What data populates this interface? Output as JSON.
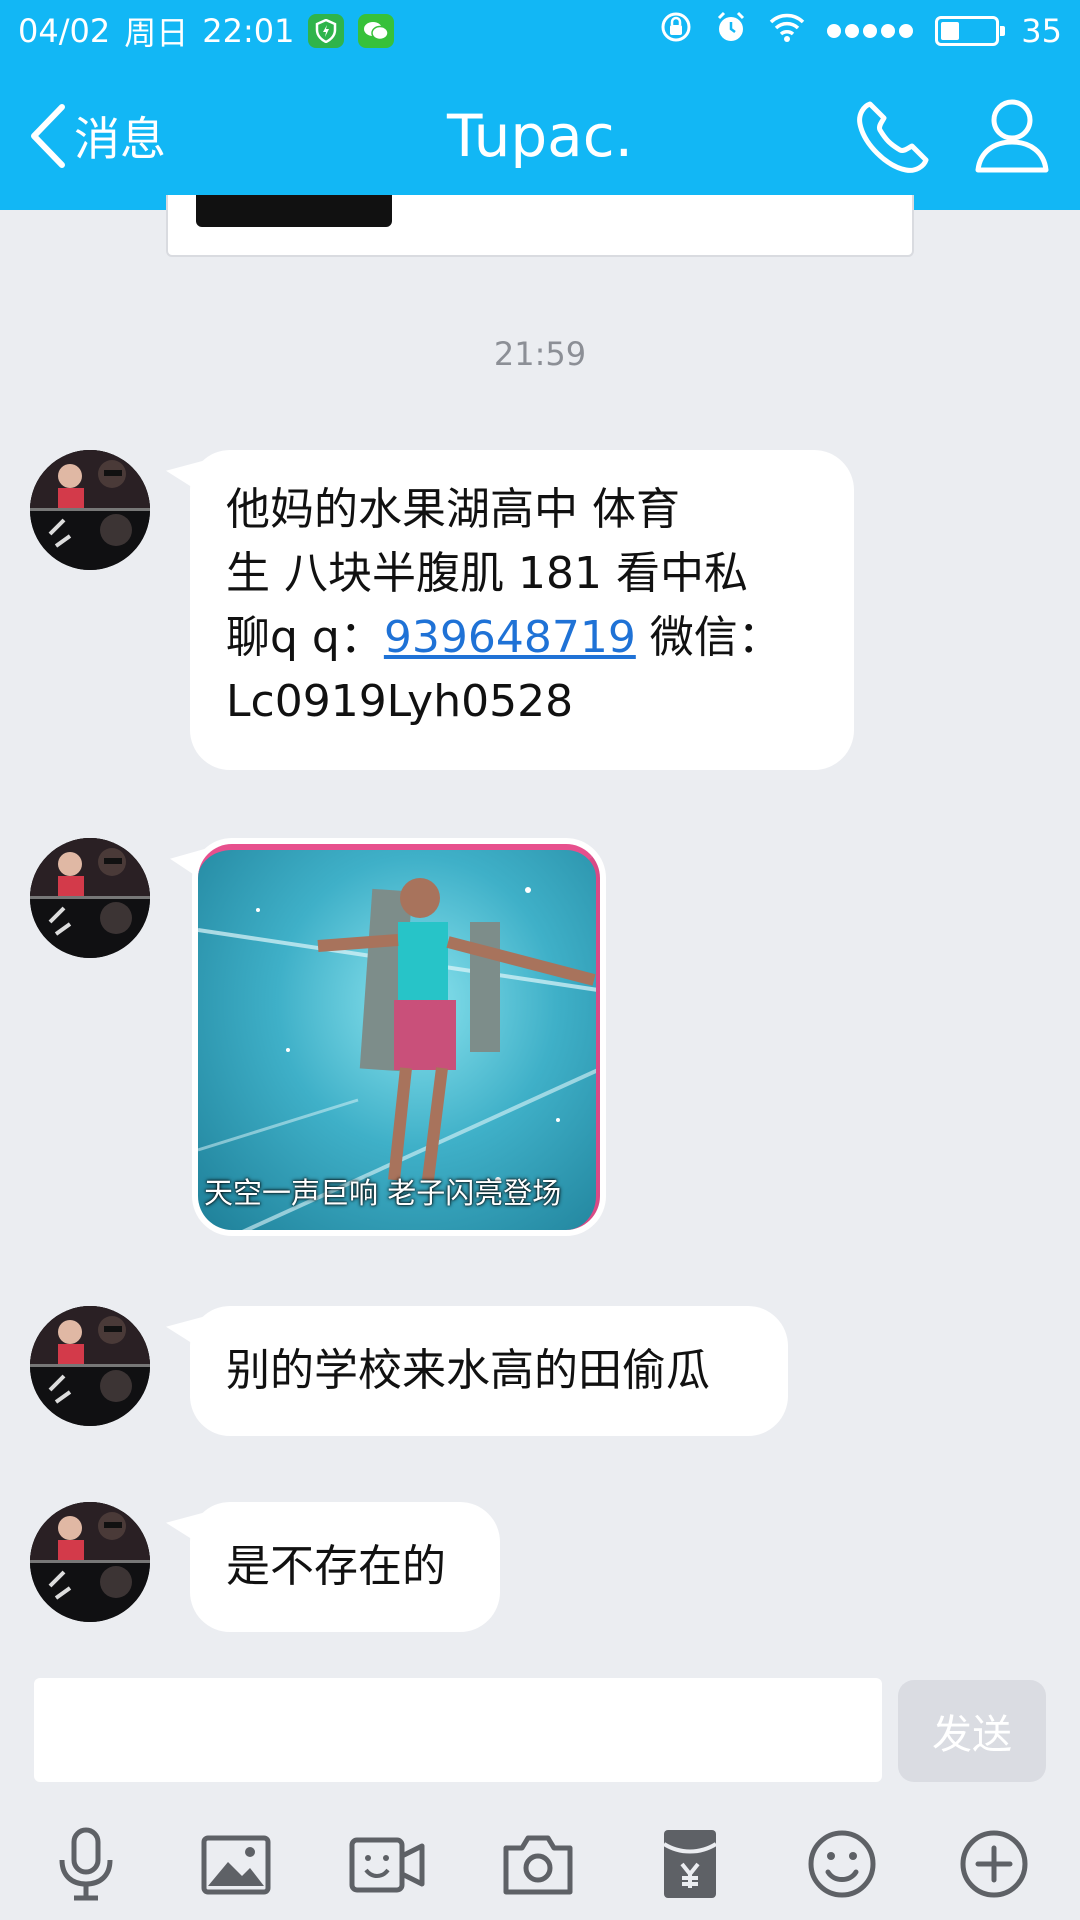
{
  "status_bar": {
    "date": "04/02",
    "weekday": "周日",
    "time": "22:01",
    "battery": "35",
    "battery_level": 0.35
  },
  "nav": {
    "back_label": "消息",
    "title": "Tupac."
  },
  "chat": {
    "timestamp": "21:59",
    "messages": [
      {
        "type": "text",
        "lines": [
          "他妈的水果湖高中 体育",
          "生 八块半腹肌 181 看中私"
        ],
        "line3_prefix": "聊q q：",
        "link": "939648719",
        "line3_suffix": " 微信：",
        "line4": "Lc0919Lyh0528"
      },
      {
        "type": "image",
        "caption": "天空一声巨响 老子闪亮登场"
      },
      {
        "type": "text",
        "text": "别的学校来水高的田偷瓜"
      },
      {
        "type": "text",
        "text": "是不存在的"
      }
    ]
  },
  "composer": {
    "input_value": "",
    "send_label": "发送"
  },
  "toolbar_icons": [
    "microphone-icon",
    "image-icon",
    "video-icon",
    "camera-icon",
    "red-packet-icon",
    "emoji-icon",
    "plus-icon"
  ],
  "colors": {
    "accent": "#12b7f5",
    "background": "#ebedf1",
    "link": "#1f72d6",
    "send_disabled": "#dadce2"
  }
}
